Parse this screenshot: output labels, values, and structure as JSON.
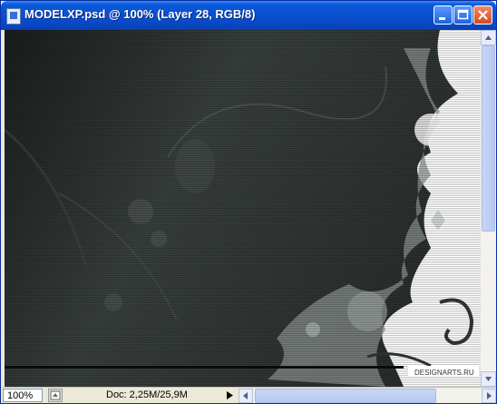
{
  "window": {
    "title": "MODELXP.psd @ 100% (Layer 28, RGB/8)",
    "title_color": "#ffffff",
    "titlebar_color": "#0a4fd0"
  },
  "canvas": {
    "background": "#2f3532",
    "watermark": "DESIGNARTS.RU"
  },
  "status": {
    "zoom": "100%",
    "doc_info": "Doc: 2,25M/25,9M"
  },
  "icons": {
    "app": "photoshop-doc-icon",
    "minimize": "minimize-icon",
    "maximize": "maximize-icon",
    "close": "close-icon",
    "scroll_up": "arrow-up-icon",
    "scroll_down": "arrow-down-icon",
    "scroll_left": "arrow-left-icon",
    "scroll_right": "arrow-right-icon",
    "nav": "navigator-icon"
  }
}
